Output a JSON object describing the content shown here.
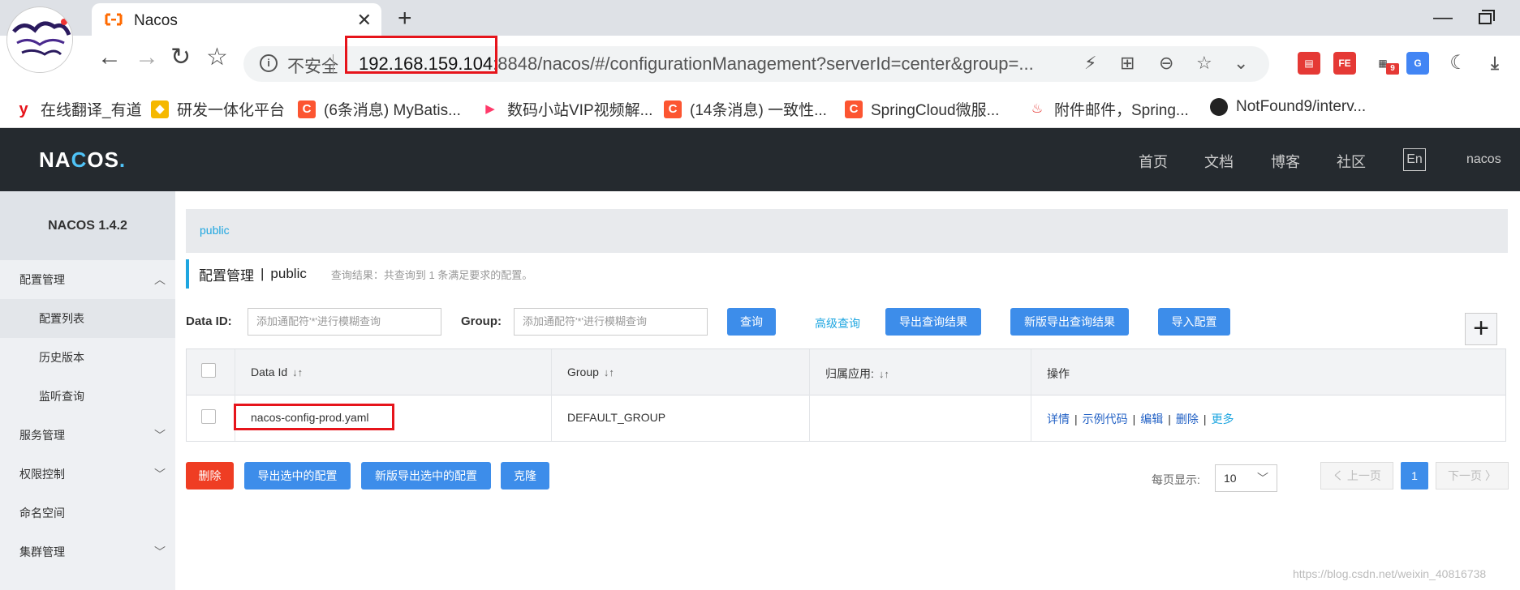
{
  "browser": {
    "tab_title": "Nacos",
    "new_tab": "+",
    "omnibox": {
      "insecure_label": "不安全",
      "url_host": "192.168.159.104",
      "url_rest": ":8848/nacos/#/configurationManagement?serverId=center&group=..."
    },
    "extension_badge": "9",
    "bookmarks": [
      {
        "label": "在线翻译_有道",
        "icon": "youdao-icon",
        "color": "#e6141b",
        "glyph": "y"
      },
      {
        "label": "研发一体化平台",
        "icon": "platform-icon",
        "color": "#f5b800",
        "glyph": "◆"
      },
      {
        "label": "(6条消息) MyBatis...",
        "icon": "csdn-icon",
        "color": "#fc5531",
        "glyph": "C"
      },
      {
        "label": "数码小站VIP视频解...",
        "icon": "video-icon",
        "color": "#ff3a6a",
        "glyph": "▶"
      },
      {
        "label": "(14条消息) 一致性...",
        "icon": "csdn-icon",
        "color": "#fc5531",
        "glyph": "C"
      },
      {
        "label": "SpringCloud微服...",
        "icon": "csdn-icon",
        "color": "#fc5531",
        "glyph": "C"
      },
      {
        "label": "附件邮件，Spring...",
        "icon": "flame-icon",
        "color": "#ffffff",
        "glyph": "🔥"
      },
      {
        "label": "NotFound9/interv...",
        "icon": "github-icon",
        "color": "#222222",
        "glyph": "●"
      }
    ]
  },
  "header": {
    "logo_a": "NA",
    "logo_b": "C",
    "logo_c": "OS",
    "logo_dot": ".",
    "nav": [
      "首页",
      "文档",
      "博客",
      "社区"
    ],
    "lang": "En",
    "user": "nacos"
  },
  "sidebar": {
    "title": "NACOS 1.4.2",
    "items": [
      {
        "label": "配置管理",
        "chevron": "︿"
      },
      {
        "label": "配置列表"
      },
      {
        "label": "历史版本"
      },
      {
        "label": "监听查询"
      },
      {
        "label": "服务管理",
        "chevron": "﹀"
      },
      {
        "label": "权限控制",
        "chevron": "﹀"
      },
      {
        "label": "命名空间"
      },
      {
        "label": "集群管理",
        "chevron": "﹀"
      }
    ]
  },
  "main": {
    "namespace_tab": "public",
    "page_title": "配置管理",
    "separator": "|",
    "namespace": "public",
    "query_result": "查询结果：共查询到 1 条满足要求的配置。",
    "search": {
      "dataid_label": "Data ID:",
      "dataid_placeholder": "添加通配符'*'进行模糊查询",
      "group_label": "Group:",
      "group_placeholder": "添加通配符'*'进行模糊查询",
      "query_btn": "查询",
      "advanced_link": "高级查询",
      "export_btn": "导出查询结果",
      "export_new_btn": "新版导出查询结果",
      "import_btn": "导入配置",
      "add_btn": "+"
    },
    "table": {
      "columns": [
        "Data Id",
        "Group",
        "归属应用:",
        "操作"
      ],
      "sort_icon": "↓↑",
      "rows": [
        {
          "data_id": "nacos-config-prod.yaml",
          "group": "DEFAULT_GROUP",
          "app": ""
        }
      ],
      "ops": [
        "详情",
        "示例代码",
        "编辑",
        "删除"
      ],
      "op_more": "更多",
      "op_sep": "|"
    },
    "bulk": {
      "delete": "删除",
      "export_selected": "导出选中的配置",
      "export_selected_new": "新版导出选中的配置",
      "clone": "克隆"
    },
    "pagination": {
      "per_page_label": "每页显示:",
      "per_page": "10",
      "prev": "く 上一页",
      "current": "1",
      "next": "下一页 〉"
    }
  },
  "watermark": "https://blog.csdn.net/weixin_40816738"
}
